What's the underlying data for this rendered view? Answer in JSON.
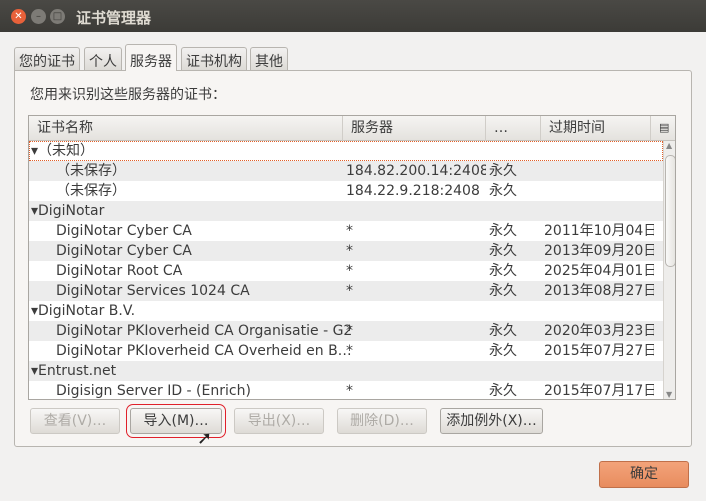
{
  "window": {
    "title": "证书管理器"
  },
  "tabs": [
    {
      "label": "您的证书"
    },
    {
      "label": "个人"
    },
    {
      "label": "服务器",
      "active": true
    },
    {
      "label": "证书机构"
    },
    {
      "label": "其他"
    }
  ],
  "description": "您用来识别这些服务器的证书：",
  "table": {
    "columns": [
      "证书名称",
      "服务器",
      "…",
      "过期时间"
    ],
    "rows": [
      {
        "name": "▾（未知）",
        "server": "",
        "trust": "",
        "expires": "",
        "group": true
      },
      {
        "name": "（未保存）",
        "server": "184.82.200.14:2408",
        "trust": "永久",
        "expires": ""
      },
      {
        "name": "（未保存）",
        "server": "184.22.9.218:2408",
        "trust": "永久",
        "expires": ""
      },
      {
        "name": "▾DigiNotar",
        "server": "",
        "trust": "",
        "expires": "",
        "group": true
      },
      {
        "name": "DigiNotar Cyber CA",
        "server": "*",
        "trust": "永久",
        "expires": "2011年10月04日"
      },
      {
        "name": "DigiNotar Cyber CA",
        "server": "*",
        "trust": "永久",
        "expires": "2013年09月20日"
      },
      {
        "name": "DigiNotar Root CA",
        "server": "*",
        "trust": "永久",
        "expires": "2025年04月01日"
      },
      {
        "name": "DigiNotar Services 1024 CA",
        "server": "*",
        "trust": "永久",
        "expires": "2013年08月27日"
      },
      {
        "name": "▾DigiNotar B.V.",
        "server": "",
        "trust": "",
        "expires": "",
        "group": true
      },
      {
        "name": "DigiNotar PKIoverheid CA Organisatie - G2",
        "server": "*",
        "trust": "永久",
        "expires": "2020年03月23日"
      },
      {
        "name": "DigiNotar PKIoverheid CA Overheid en B…",
        "server": "*",
        "trust": "永久",
        "expires": "2015年07月27日"
      },
      {
        "name": "▾Entrust.net",
        "server": "",
        "trust": "",
        "expires": "",
        "group": true
      },
      {
        "name": "Digisign Server ID - (Enrich)",
        "server": "*",
        "trust": "永久",
        "expires": "2015年07月17日"
      }
    ]
  },
  "buttons": {
    "view": "查看(V)…",
    "import": "导入(M)…",
    "export": "导出(X)…",
    "delete": "删除(D)…",
    "add_exception": "添加例外(X)…",
    "ok": "确定"
  },
  "colors": {
    "highlight": "#e0202a",
    "ok": "#e88c5e"
  }
}
